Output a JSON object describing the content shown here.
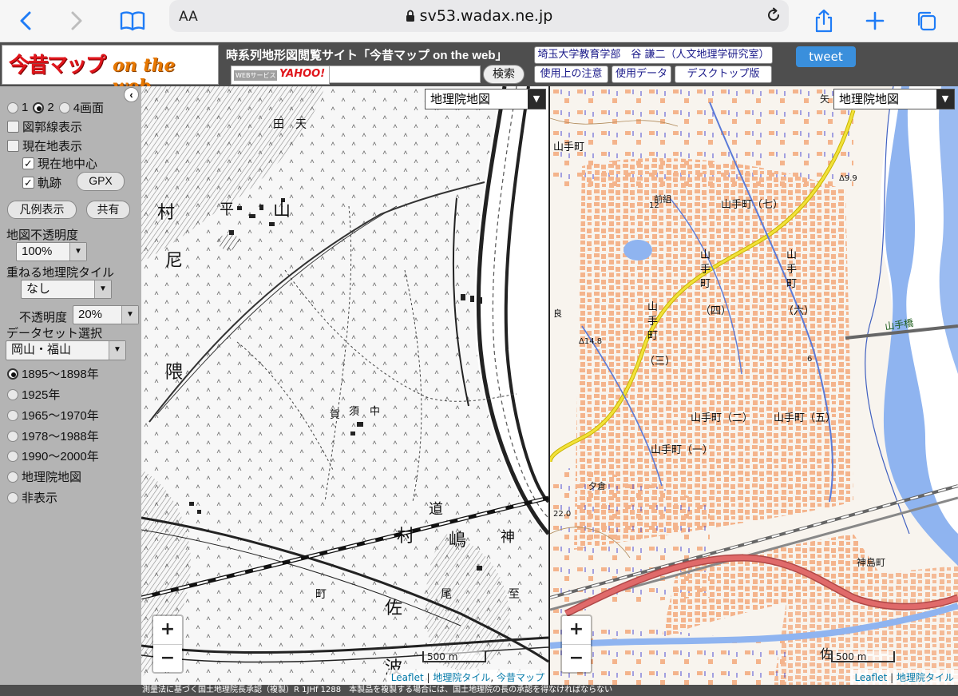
{
  "browser": {
    "text_size_label": "AA",
    "url": "sv53.wadax.ne.jp"
  },
  "header": {
    "logo_jp": "今昔マップ",
    "logo_en": "on the web",
    "site_title": "時系列地形図閲覧サイト「今昔マップ on the web」",
    "yahoo_badge_small": "WEBサービス",
    "yahoo_badge_brand": "YAHOO!",
    "search_value": "",
    "search_button": "検索",
    "author": "埼玉大学教育学部　谷 謙二（人文地理学研究室）",
    "buttons": {
      "usage_notes": "使用上の注意",
      "usage_data": "使用データ",
      "desktop": "デスクトップ版"
    },
    "tweet": "tweet"
  },
  "panel": {
    "collapse_icon": "‹",
    "screen_options": [
      "1",
      "2",
      "4画面"
    ],
    "screen_selected": "2",
    "graticule_label": "図郭線表示",
    "current_location_label": "現在地表示",
    "center_label": "現在地中心",
    "track_label": "軌跡",
    "gpx_button": "GPX",
    "legend_button": "凡例表示",
    "share_button": "共有",
    "opacity_label": "地図不透明度",
    "opacity_value": "100%",
    "overlay_label": "重ねる地理院タイル",
    "overlay_value": "なし",
    "overlay_opacity_label": "不透明度",
    "overlay_opacity_value": "20%",
    "dataset_label": "データセット選択",
    "dataset_value": "岡山・福山",
    "eras": [
      "1895〜1898年",
      "1925年",
      "1965〜1970年",
      "1978〜1988年",
      "1990〜2000年",
      "地理院地図",
      "非表示"
    ],
    "era_selected": "1895〜1898年"
  },
  "map_left": {
    "layer_select": "地理院地図",
    "labels": [
      "田",
      "天",
      "村",
      "山",
      "平",
      "尼",
      "隈",
      "賀",
      "須",
      "中",
      "道",
      "村",
      "嶋",
      "神",
      "町",
      "佐",
      "波",
      "尾",
      "至"
    ],
    "scale": "500 m",
    "attribution": [
      "Leaflet",
      "地理院タイル",
      "今昔マップ"
    ]
  },
  "map_right": {
    "layer_select": "地理院地図",
    "labels": [
      "山手町",
      "山手町（七）",
      "前組",
      "山手町（四）",
      "山手町（六）",
      "山手町（三）",
      "山手町（二）",
      "山手町（五）",
      "山手町（一）",
      "神島町",
      "夕倉",
      "山手橋",
      "矢",
      "良",
      "佐"
    ],
    "spot_heights": [
      "Δ14.8",
      "Δ9.9",
      "22.0",
      "6",
      "12"
    ],
    "scale": "500 m",
    "attribution": [
      "Leaflet",
      "地理院タイル"
    ]
  },
  "zoom": {
    "in": "+",
    "out": "−"
  },
  "footer": "測量法に基づく国土地理院長承認（複製）R 1JHf 1288　本製品を複製する場合には、国土地理院の長の承認を得なければならない",
  "colors": {
    "header_bg": "#4e4e4e",
    "panel_bg": "#b4b4b4",
    "tweet_bg": "#3a8fdc",
    "river_blue": "#8fb4f0",
    "building_orange": "#f4b48c",
    "expressway_red": "#e06a6a",
    "national_road_yellow": "#f2e23a"
  }
}
